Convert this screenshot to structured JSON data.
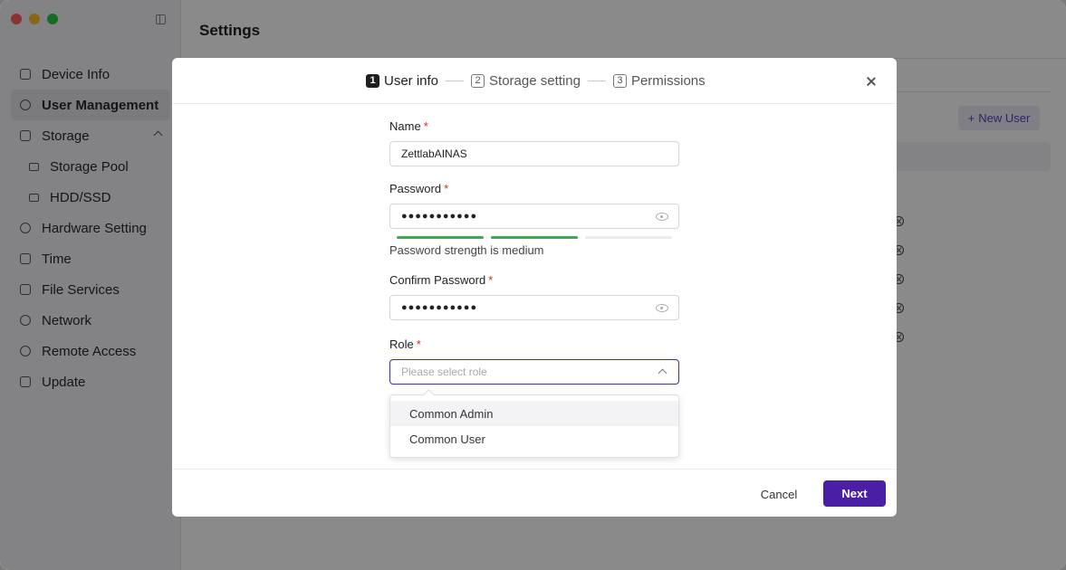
{
  "page": {
    "title": "Settings"
  },
  "sidebar": {
    "items": [
      {
        "label": "Device Info",
        "icon": "device-info-icon"
      },
      {
        "label": "User Management",
        "icon": "user-icon",
        "active": true
      },
      {
        "label": "Storage",
        "icon": "storage-icon",
        "expanded": true
      },
      {
        "label": "Storage Pool",
        "icon": "storage-pool-icon",
        "sub": true
      },
      {
        "label": "HDD/SSD",
        "icon": "disk-icon",
        "sub": true
      },
      {
        "label": "Hardware Setting",
        "icon": "hardware-icon"
      },
      {
        "label": "Time",
        "icon": "clock-icon"
      },
      {
        "label": "File Services",
        "icon": "file-icon"
      },
      {
        "label": "Network",
        "icon": "globe-icon"
      },
      {
        "label": "Remote Access",
        "icon": "remote-icon"
      },
      {
        "label": "Update",
        "icon": "update-icon"
      }
    ]
  },
  "main": {
    "new_user_label": "New User"
  },
  "modal": {
    "steps": [
      {
        "num": "1",
        "label": "User info",
        "current": true
      },
      {
        "num": "2",
        "label": "Storage setting"
      },
      {
        "num": "3",
        "label": "Permissions"
      }
    ],
    "name": {
      "label": "Name",
      "value": "ZettlabAINAS"
    },
    "password": {
      "label": "Password",
      "value": "●●●●●●●●●●●",
      "strength_text": "Password strength is medium",
      "strength_level": 2,
      "strength_max": 3
    },
    "confirm": {
      "label": "Confirm Password",
      "value": "●●●●●●●●●●●"
    },
    "role": {
      "label": "Role",
      "placeholder": "Please select role",
      "options": [
        "Common Admin",
        "Common User"
      ]
    },
    "cancel_label": "Cancel",
    "next_label": "Next"
  },
  "colors": {
    "accent": "#4a1fa6",
    "required": "#e0271a",
    "strength": "#3aab4e"
  }
}
